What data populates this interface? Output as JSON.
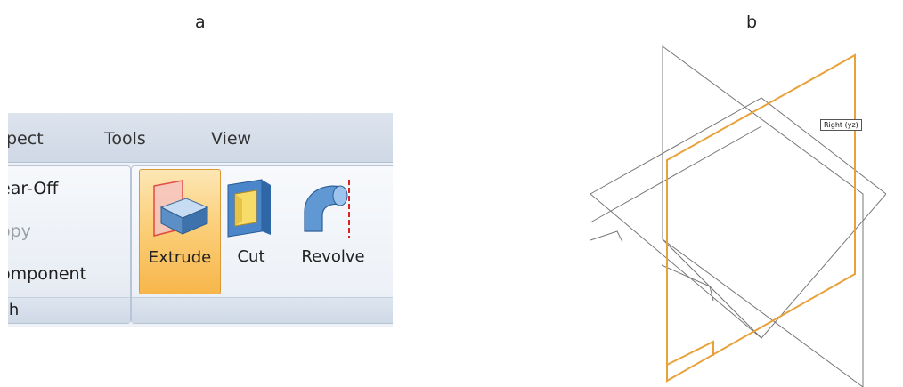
{
  "panel_a_label": "a",
  "panel_b_label": "b",
  "ribbon": {
    "tabs": [
      "pect",
      "Tools",
      "View"
    ],
    "left_group": {
      "items": [
        {
          "label": "ear-Off",
          "enabled": true
        },
        {
          "label": "opy",
          "enabled": false
        },
        {
          "label": "omponent",
          "enabled": true
        }
      ],
      "footer": "ch"
    },
    "buttons": [
      {
        "label": "Extrude",
        "icon": "extrude-icon",
        "active": true
      },
      {
        "label": "Cut",
        "icon": "cut-icon",
        "active": false
      },
      {
        "label": "Revolve",
        "icon": "revolve-icon",
        "active": false
      }
    ]
  },
  "cad": {
    "plane_tooltip": "Right (yz)",
    "highlight_color": "#e9a23b"
  }
}
